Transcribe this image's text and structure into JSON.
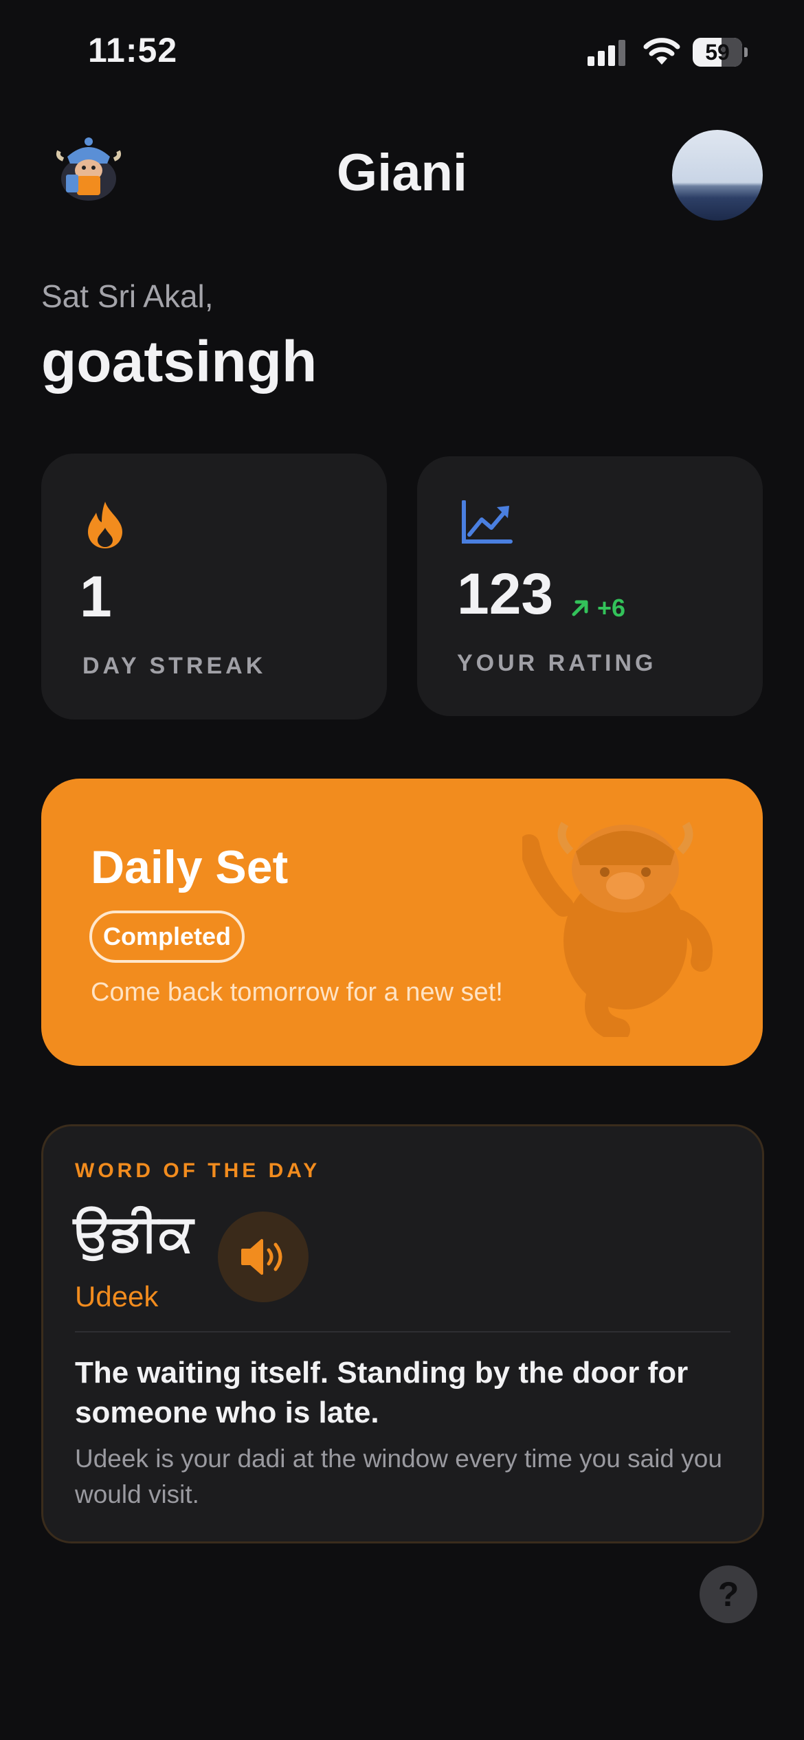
{
  "status_bar": {
    "time": "11:52",
    "battery": "59"
  },
  "header": {
    "title": "Giani"
  },
  "greeting": {
    "salutation": "Sat Sri Akal,",
    "username": "goatsingh"
  },
  "stats": {
    "streak": {
      "value": "1",
      "label": "DAY STREAK",
      "icon": "flame-icon"
    },
    "rating": {
      "value": "123",
      "delta": "+6",
      "label": "YOUR RATING",
      "icon": "trend-chart-icon"
    }
  },
  "daily_set": {
    "title": "Daily Set",
    "status": "Completed",
    "subtitle": "Come back tomorrow for a new set!"
  },
  "word_of_day": {
    "label": "WORD OF THE DAY",
    "word": "ਉਡੀਕ",
    "transliteration": "Udeek",
    "meaning": "The waiting itself. Standing by the door for someone who is late.",
    "example": "Udeek is your dadi at the window every time you said you would visit."
  },
  "help": {
    "label": "?"
  },
  "colors": {
    "accent": "#f28c1e",
    "positive": "#33c25a",
    "chart_icon": "#4a7fe0",
    "background": "#0e0e10",
    "card": "#1c1c1e"
  }
}
